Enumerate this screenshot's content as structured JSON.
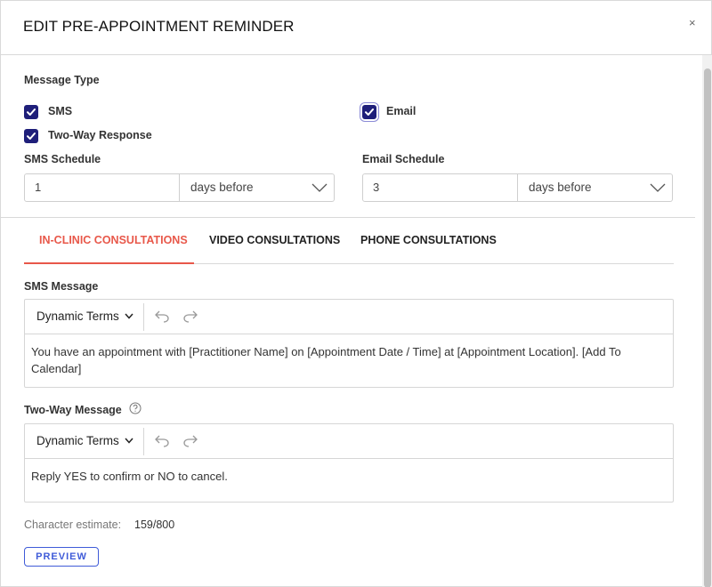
{
  "dialog": {
    "title": "EDIT PRE-APPOINTMENT REMINDER",
    "close_glyph": "×"
  },
  "message_type": {
    "label": "Message Type",
    "sms": {
      "label": "SMS",
      "checked": true
    },
    "email": {
      "label": "Email",
      "checked": true
    },
    "two_way": {
      "label": "Two-Way Response",
      "checked": true
    }
  },
  "sms_schedule": {
    "label": "SMS Schedule",
    "value": "1",
    "unit": "days before"
  },
  "email_schedule": {
    "label": "Email Schedule",
    "value": "3",
    "unit": "days before"
  },
  "tabs": [
    {
      "label": "IN-CLINIC CONSULTATIONS",
      "active": true
    },
    {
      "label": "VIDEO CONSULTATIONS",
      "active": false
    },
    {
      "label": "PHONE CONSULTATIONS",
      "active": false
    }
  ],
  "sms_message": {
    "label": "SMS Message",
    "dynamic_terms": "Dynamic Terms",
    "content": "You have an appointment with [Practitioner Name] on [Appointment Date / Time] at [Appointment Location]. [Add To Calendar]"
  },
  "two_way_message": {
    "label": "Two-Way Message",
    "dynamic_terms": "Dynamic Terms",
    "content": "Reply YES to confirm or NO to cancel."
  },
  "character_estimate": {
    "label": "Character estimate:",
    "value": "159/800"
  },
  "preview_label": "PREVIEW",
  "colors": {
    "accent": "#e8584a",
    "checkbox": "#1f1f7a",
    "link": "#3f5bd8"
  },
  "icons": [
    "close-icon",
    "checkmark-icon",
    "chevron-down-icon",
    "undo-icon",
    "redo-icon",
    "help-circle-icon"
  ]
}
